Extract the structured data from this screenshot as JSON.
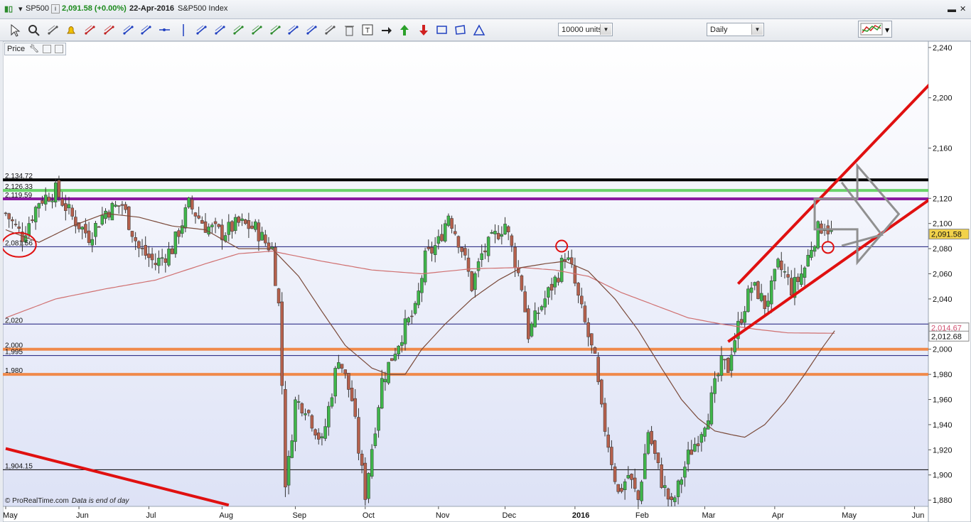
{
  "window": {
    "symbol": "SP500",
    "info_icon": "info-icon",
    "last": "2,091.58 (+0.00%)",
    "date": "22-Apr-2016",
    "name": "S&P500 Index"
  },
  "toolbar": {
    "icons": [
      "pointer-icon",
      "zoom-icon",
      "ruler-icon",
      "alert-bell-icon",
      "fibonacci-icon",
      "fib-retracement-icon",
      "line-icon",
      "trendline-icon",
      "horizontal-line-icon",
      "vertical-line-icon",
      "channel-icon",
      "andrews-pitchfork-icon",
      "zigzag-icon",
      "fan-icon",
      "arc-icon",
      "parallel-lines-icon",
      "regression-icon",
      "hammer-icon",
      "trash-icon",
      "text-icon",
      "arrow-right-icon",
      "arrow-up-green-icon",
      "arrow-down-red-icon",
      "rectangle-icon",
      "polygon-icon",
      "triangle-icon"
    ],
    "units": "10000 units",
    "timeframe": "Daily",
    "indicator_icon": "indicators-icon"
  },
  "pane": {
    "label": "Price"
  },
  "footer": {
    "copyright": "© ProRealTime.com",
    "note": "Data is end of day"
  },
  "colors": {
    "up": "#3fb64a",
    "down": "#b5604c",
    "ma_short": "#7a4a3a",
    "ma_long": "#d07070",
    "line_black": "#000000",
    "line_green": "#6ad46a",
    "line_purple": "#8a1aa0",
    "line_orange": "#f08a4b",
    "line_red": "#e01010",
    "line_navy": "#1a1a7a",
    "bg_top": "#ffffff",
    "bg_bottom": "#dde2f6"
  },
  "chart_data": {
    "type": "candlestick",
    "title": "SP500",
    "ylim": [
      1875,
      2245
    ],
    "y_ticks": [
      "2,240",
      "2,200",
      "2,160",
      "2,120",
      "2,100",
      "2,080",
      "2,060",
      "2,040",
      "2,000",
      "1,980",
      "1,960",
      "1,940",
      "1,920",
      "1,900",
      "1,880"
    ],
    "y_tick_values": [
      2240,
      2200,
      2160,
      2120,
      2100,
      2080,
      2060,
      2040,
      2000,
      1980,
      1960,
      1940,
      1920,
      1900,
      1880
    ],
    "x_labels": [
      "May",
      "Jun",
      "Jul",
      "Aug",
      "Sep",
      "Oct",
      "Nov",
      "Dec",
      "2016",
      "Feb",
      "Mar",
      "Apr",
      "May",
      "Jun"
    ],
    "x_label_index": [
      0,
      22,
      43,
      65,
      87,
      108,
      130,
      150,
      171,
      190,
      210,
      231,
      252,
      273
    ],
    "n_slots": 278,
    "horizontal_lines": [
      {
        "label": "2,134.72",
        "value": 2134.72,
        "color": "#000000"
      },
      {
        "label": "2,126.33",
        "value": 2126.33,
        "color": "#6ad46a"
      },
      {
        "label": "2,119.59",
        "value": 2119.59,
        "color": "#8a1aa0"
      },
      {
        "label": "2,081.56",
        "value": 2081.56,
        "color": "#1a1a7a"
      },
      {
        "label": "2,020",
        "value": 2020,
        "color": "#1a1a7a"
      },
      {
        "label": "2,000",
        "value": 2000,
        "color": "#f08a4b"
      },
      {
        "label": "1,995",
        "value": 1995,
        "color": "#1a1a7a"
      },
      {
        "label": "1,980",
        "value": 1980,
        "color": "#f08a4b"
      },
      {
        "label": "1,904.15",
        "value": 1904.15,
        "color": "#000000"
      }
    ],
    "price_tags": [
      {
        "label": "2,091.58",
        "value": 2091.58
      },
      {
        "label": "2,014.67",
        "value": 2014.67
      },
      {
        "label": "2,012.68",
        "value": 2012.68
      }
    ],
    "close_series": [
      {
        "i": 0,
        "v": 2108
      },
      {
        "i": 5,
        "v": 2090
      },
      {
        "i": 10,
        "v": 2118
      },
      {
        "i": 15,
        "v": 2126
      },
      {
        "i": 20,
        "v": 2105
      },
      {
        "i": 25,
        "v": 2090
      },
      {
        "i": 30,
        "v": 2110
      },
      {
        "i": 35,
        "v": 2115
      },
      {
        "i": 40,
        "v": 2080
      },
      {
        "i": 45,
        "v": 2068
      },
      {
        "i": 50,
        "v": 2080
      },
      {
        "i": 55,
        "v": 2115
      },
      {
        "i": 60,
        "v": 2098
      },
      {
        "i": 65,
        "v": 2092
      },
      {
        "i": 70,
        "v": 2100
      },
      {
        "i": 75,
        "v": 2096
      },
      {
        "i": 78,
        "v": 2085
      },
      {
        "i": 80,
        "v": 2080
      },
      {
        "i": 82,
        "v": 2035
      },
      {
        "i": 83,
        "v": 1972
      },
      {
        "i": 84,
        "v": 1895
      },
      {
        "i": 85,
        "v": 1910
      },
      {
        "i": 87,
        "v": 1958
      },
      {
        "i": 90,
        "v": 1955
      },
      {
        "i": 95,
        "v": 1925
      },
      {
        "i": 100,
        "v": 1995
      },
      {
        "i": 104,
        "v": 1960
      },
      {
        "i": 106,
        "v": 1920
      },
      {
        "i": 108,
        "v": 1885
      },
      {
        "i": 110,
        "v": 1922
      },
      {
        "i": 113,
        "v": 1975
      },
      {
        "i": 117,
        "v": 2000
      },
      {
        "i": 120,
        "v": 2018
      },
      {
        "i": 123,
        "v": 2030
      },
      {
        "i": 126,
        "v": 2072
      },
      {
        "i": 130,
        "v": 2085
      },
      {
        "i": 133,
        "v": 2108
      },
      {
        "i": 137,
        "v": 2080
      },
      {
        "i": 140,
        "v": 2050
      },
      {
        "i": 143,
        "v": 2075
      },
      {
        "i": 147,
        "v": 2090
      },
      {
        "i": 150,
        "v": 2100
      },
      {
        "i": 153,
        "v": 2070
      },
      {
        "i": 155,
        "v": 2050
      },
      {
        "i": 157,
        "v": 2012
      },
      {
        "i": 160,
        "v": 2030
      },
      {
        "i": 163,
        "v": 2045
      },
      {
        "i": 166,
        "v": 2060
      },
      {
        "i": 168,
        "v": 2075
      },
      {
        "i": 170,
        "v": 2063
      },
      {
        "i": 172,
        "v": 2040
      },
      {
        "i": 175,
        "v": 2010
      },
      {
        "i": 177,
        "v": 1990
      },
      {
        "i": 179,
        "v": 1950
      },
      {
        "i": 181,
        "v": 1925
      },
      {
        "i": 184,
        "v": 1885
      },
      {
        "i": 187,
        "v": 1900
      },
      {
        "i": 190,
        "v": 1880
      },
      {
        "i": 193,
        "v": 1935
      },
      {
        "i": 197,
        "v": 1895
      },
      {
        "i": 200,
        "v": 1875
      },
      {
        "i": 202,
        "v": 1890
      },
      {
        "i": 205,
        "v": 1915
      },
      {
        "i": 208,
        "v": 1930
      },
      {
        "i": 211,
        "v": 1950
      },
      {
        "i": 213,
        "v": 1970
      },
      {
        "i": 215,
        "v": 1988
      },
      {
        "i": 217,
        "v": 1985
      },
      {
        "i": 218,
        "v": 2000
      },
      {
        "i": 220,
        "v": 2018
      },
      {
        "i": 222,
        "v": 2035
      },
      {
        "i": 224,
        "v": 2050
      },
      {
        "i": 226,
        "v": 2045
      },
      {
        "i": 228,
        "v": 2035
      },
      {
        "i": 230,
        "v": 2048
      },
      {
        "i": 232,
        "v": 2066
      },
      {
        "i": 234,
        "v": 2060
      },
      {
        "i": 236,
        "v": 2048
      },
      {
        "i": 238,
        "v": 2055
      },
      {
        "i": 240,
        "v": 2065
      },
      {
        "i": 242,
        "v": 2082
      },
      {
        "i": 244,
        "v": 2095
      },
      {
        "i": 246,
        "v": 2100
      },
      {
        "i": 248,
        "v": 2091.58
      }
    ],
    "ma_short": [
      {
        "i": 0,
        "v": 2095
      },
      {
        "i": 10,
        "v": 2085
      },
      {
        "i": 20,
        "v": 2098
      },
      {
        "i": 30,
        "v": 2108
      },
      {
        "i": 40,
        "v": 2105
      },
      {
        "i": 50,
        "v": 2098
      },
      {
        "i": 60,
        "v": 2095
      },
      {
        "i": 70,
        "v": 2080
      },
      {
        "i": 80,
        "v": 2080
      },
      {
        "i": 88,
        "v": 2058
      },
      {
        "i": 95,
        "v": 2030
      },
      {
        "i": 102,
        "v": 2003
      },
      {
        "i": 110,
        "v": 1985
      },
      {
        "i": 115,
        "v": 1980
      },
      {
        "i": 120,
        "v": 1980
      },
      {
        "i": 125,
        "v": 2000
      },
      {
        "i": 132,
        "v": 2020
      },
      {
        "i": 140,
        "v": 2040
      },
      {
        "i": 148,
        "v": 2055
      },
      {
        "i": 155,
        "v": 2065
      },
      {
        "i": 162,
        "v": 2068
      },
      {
        "i": 168,
        "v": 2070
      },
      {
        "i": 175,
        "v": 2062
      },
      {
        "i": 183,
        "v": 2040
      },
      {
        "i": 190,
        "v": 2015
      },
      {
        "i": 197,
        "v": 1985
      },
      {
        "i": 203,
        "v": 1960
      },
      {
        "i": 208,
        "v": 1945
      },
      {
        "i": 213,
        "v": 1935
      },
      {
        "i": 218,
        "v": 1932
      },
      {
        "i": 222,
        "v": 1930
      },
      {
        "i": 228,
        "v": 1940
      },
      {
        "i": 234,
        "v": 1958
      },
      {
        "i": 240,
        "v": 1980
      },
      {
        "i": 245,
        "v": 2000
      },
      {
        "i": 249,
        "v": 2014.67
      }
    ],
    "ma_long": [
      {
        "i": 0,
        "v": 2025
      },
      {
        "i": 15,
        "v": 2040
      },
      {
        "i": 30,
        "v": 2048
      },
      {
        "i": 45,
        "v": 2055
      },
      {
        "i": 60,
        "v": 2068
      },
      {
        "i": 70,
        "v": 2076
      },
      {
        "i": 80,
        "v": 2078
      },
      {
        "i": 95,
        "v": 2070
      },
      {
        "i": 110,
        "v": 2063
      },
      {
        "i": 125,
        "v": 2060
      },
      {
        "i": 140,
        "v": 2064
      },
      {
        "i": 155,
        "v": 2065
      },
      {
        "i": 165,
        "v": 2063
      },
      {
        "i": 175,
        "v": 2058
      },
      {
        "i": 185,
        "v": 2045
      },
      {
        "i": 195,
        "v": 2035
      },
      {
        "i": 205,
        "v": 2025
      },
      {
        "i": 215,
        "v": 2020
      },
      {
        "i": 225,
        "v": 2016
      },
      {
        "i": 235,
        "v": 2013
      },
      {
        "i": 249,
        "v": 2012.68
      }
    ],
    "trend_lines": [
      {
        "from": [
          217,
          2006
        ],
        "to": [
          278,
          2120
        ],
        "color": "#e01010"
      },
      {
        "from": [
          220,
          2052
        ],
        "to": [
          278,
          2212
        ],
        "color": "#e01010"
      },
      {
        "from": [
          0,
          1921
        ],
        "to": [
          67,
          1876
        ],
        "color": "#e01010"
      }
    ],
    "circles": [
      {
        "i": 4,
        "v": 2083
      },
      {
        "i": 167,
        "v": 2082
      },
      {
        "i": 247,
        "v": 2081
      }
    ],
    "arrow_shape": {
      "x": [
        243,
        264
      ],
      "v": [
        2080,
        2135
      ]
    }
  }
}
